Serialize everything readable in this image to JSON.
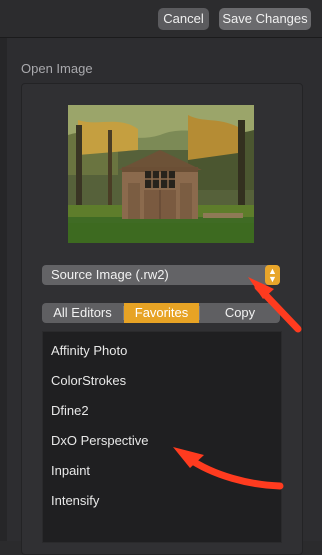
{
  "toolbar": {
    "cancel_label": "Cancel",
    "save_label": "Save Changes"
  },
  "section": {
    "label": "Open Image"
  },
  "source_selector": {
    "value": "Source Image (.rw2)"
  },
  "tabs": [
    {
      "label": "All Editors"
    },
    {
      "label": "Favorites"
    },
    {
      "label": "Copy"
    }
  ],
  "editors": [
    {
      "label": "Affinity Photo"
    },
    {
      "label": "ColorStrokes"
    },
    {
      "label": "Dfine2"
    },
    {
      "label": "DxO Perspective"
    },
    {
      "label": "Inpaint"
    },
    {
      "label": "Intensify"
    }
  ],
  "colors": {
    "accent": "#e7a325",
    "annotation_arrow": "#ff3b1f"
  }
}
